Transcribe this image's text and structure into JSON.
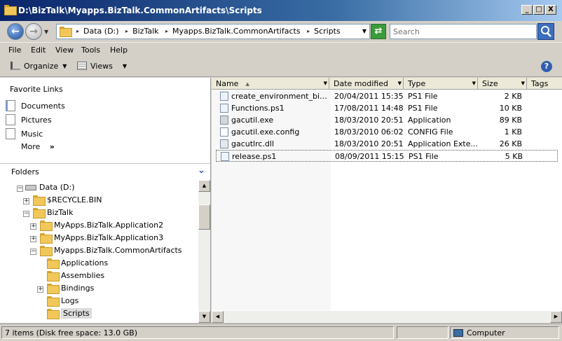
{
  "window": {
    "title": "D:\\BizTalk\\Myapps.BizTalk.CommonArtifacts\\Scripts",
    "minimize": "_",
    "maximize": "□",
    "close": "X"
  },
  "address": {
    "crumbs": [
      "Data (D:)",
      "BizTalk",
      "Myapps.BizTalk.CommonArtifacts",
      "Scripts"
    ],
    "search_placeholder": "Search"
  },
  "menu": [
    "File",
    "Edit",
    "View",
    "Tools",
    "Help"
  ],
  "toolbar": {
    "organize": "Organize",
    "views": "Views",
    "help": "?"
  },
  "favorites": {
    "title": "Favorite Links",
    "items": [
      "Documents",
      "Pictures",
      "Music"
    ],
    "more": "More",
    "more_glyph": "»"
  },
  "folders": {
    "title": "Folders",
    "tree": [
      {
        "label": "Data (D:)",
        "exp": "−"
      },
      {
        "label": "$RECYCLE.BIN",
        "exp": "+"
      },
      {
        "label": "BizTalk",
        "exp": "−"
      },
      {
        "label": "MyApps.BizTalk.Application2",
        "exp": "+"
      },
      {
        "label": "MyApps.BizTalk.Application3",
        "exp": "+"
      },
      {
        "label": "Myapps.BizTalk.CommonArtifacts",
        "exp": "−"
      },
      {
        "label": "Applications",
        "exp": ""
      },
      {
        "label": "Assemblies",
        "exp": ""
      },
      {
        "label": "Bindings",
        "exp": "+"
      },
      {
        "label": "Logs",
        "exp": ""
      },
      {
        "label": "Scripts",
        "exp": ""
      }
    ]
  },
  "columns": {
    "name": "Name",
    "date": "Date modified",
    "type": "Type",
    "size": "Size",
    "tags": "Tags"
  },
  "files": [
    {
      "name": "create_environment_bindi...",
      "date": "20/04/2011 15:35",
      "type": "PS1 File",
      "size": "2 KB"
    },
    {
      "name": "Functions.ps1",
      "date": "17/08/2011 14:48",
      "type": "PS1 File",
      "size": "10 KB"
    },
    {
      "name": "gacutil.exe",
      "date": "18/03/2010 20:51",
      "type": "Application",
      "size": "89 KB"
    },
    {
      "name": "gacutil.exe.config",
      "date": "18/03/2010 06:02",
      "type": "CONFIG File",
      "size": "1 KB"
    },
    {
      "name": "gacutlrc.dll",
      "date": "18/03/2010 20:51",
      "type": "Application Exte...",
      "size": "26 KB"
    },
    {
      "name": "release.ps1",
      "date": "08/09/2011 15:15",
      "type": "PS1 File",
      "size": "5 KB"
    }
  ],
  "status": {
    "left": "7 items (Disk free space: 13.0 GB)",
    "right": "Computer"
  },
  "colors": {
    "title_start": "#0a246a",
    "title_end": "#a6caf0",
    "folder": "#f2c75a",
    "accent": "#3a6ea5"
  }
}
